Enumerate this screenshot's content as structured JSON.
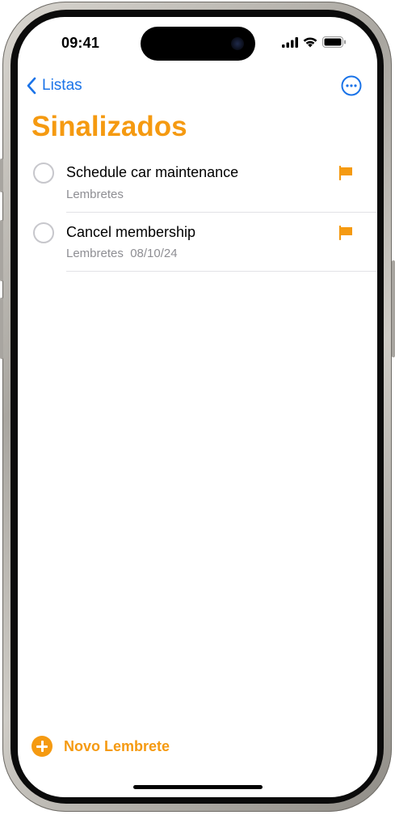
{
  "status_bar": {
    "time": "09:41",
    "icons": [
      "signal-icon",
      "wifi-icon",
      "battery-icon"
    ]
  },
  "nav": {
    "back_label": "Listas",
    "back_icon": "chevron-left-icon",
    "more_icon": "ellipsis-circle-icon"
  },
  "page": {
    "title": "Sinalizados"
  },
  "reminders": [
    {
      "title": "Schedule car maintenance",
      "list": "Lembretes",
      "date": "",
      "flagged": true
    },
    {
      "title": "Cancel membership",
      "list": "Lembretes",
      "date": "08/10/24",
      "flagged": true
    }
  ],
  "reminders_sub": [
    "Lembretes",
    "Lembretes  08/10/24"
  ],
  "footer": {
    "new_label": "Novo Lembrete",
    "new_icon": "plus-circle-icon"
  },
  "colors": {
    "accent_orange": "#f59a11",
    "link_blue": "#1a73e8",
    "secondary_text": "#8e8e93"
  }
}
